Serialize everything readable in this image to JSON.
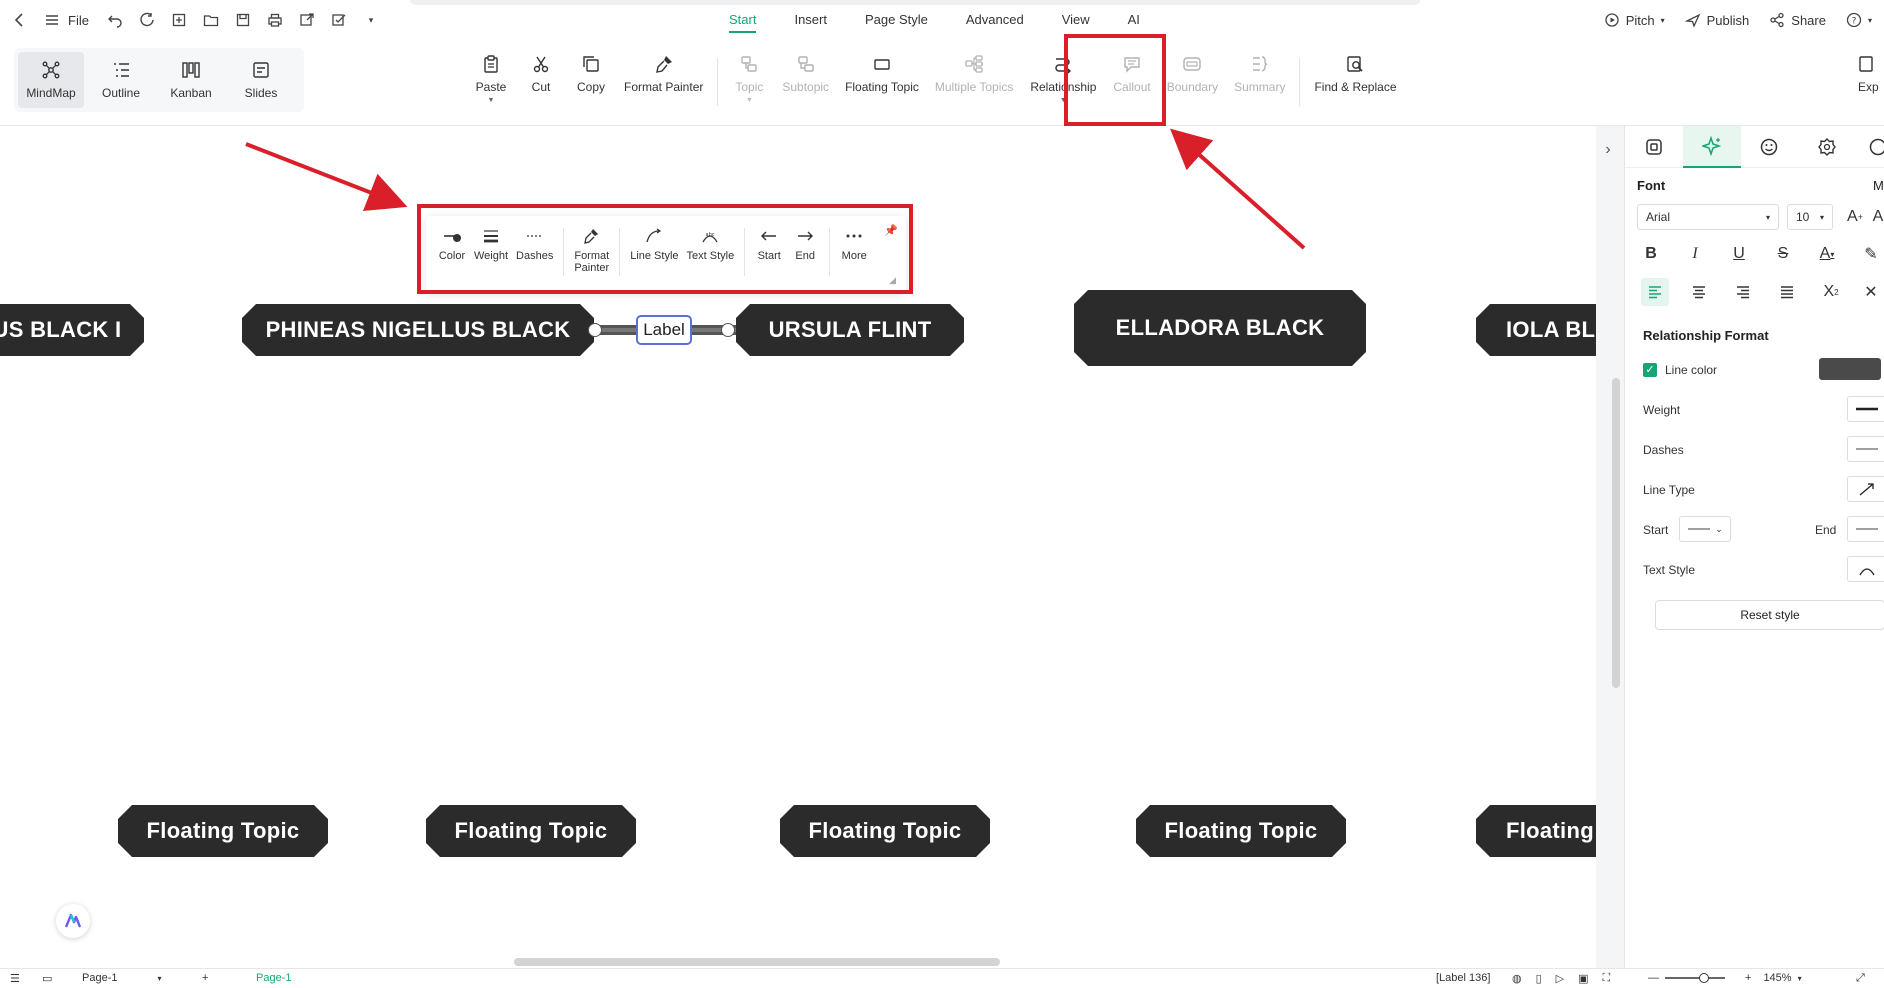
{
  "titlebar": {
    "file_label": "File",
    "tabs": [
      {
        "label": "Start",
        "active": true
      },
      {
        "label": "Insert"
      },
      {
        "label": "Page Style"
      },
      {
        "label": "Advanced"
      },
      {
        "label": "View"
      },
      {
        "label": "AI"
      }
    ],
    "right": {
      "pitch": "Pitch",
      "publish": "Publish",
      "share": "Share"
    }
  },
  "ribbon": {
    "views": [
      {
        "label": "MindMap",
        "icon": "mindmap-icon",
        "active": true
      },
      {
        "label": "Outline",
        "icon": "outline-icon"
      },
      {
        "label": "Kanban",
        "icon": "kanban-icon"
      },
      {
        "label": "Slides",
        "icon": "slides-icon"
      }
    ],
    "tools": {
      "paste": "Paste",
      "cut": "Cut",
      "copy": "Copy",
      "format_painter": "Format Painter",
      "topic": "Topic",
      "subtopic": "Subtopic",
      "floating_topic": "Floating Topic",
      "multiple_topics": "Multiple Topics",
      "relationship": "Relationship",
      "callout": "Callout",
      "boundary": "Boundary",
      "summary": "Summary",
      "find_replace": "Find & Replace",
      "export": "Exp"
    }
  },
  "canvas": {
    "topics": [
      {
        "label": "US BLACK I"
      },
      {
        "label": "PHINEAS NIGELLUS BLACK"
      },
      {
        "label": "URSULA  FLINT"
      },
      {
        "label": "ELLADORA  BLACK"
      },
      {
        "label": "IOLA BLAC"
      }
    ],
    "floating_topics": [
      {
        "label": "Floating Topic"
      },
      {
        "label": "Floating Topic"
      },
      {
        "label": "Floating Topic"
      },
      {
        "label": "Floating Topic"
      },
      {
        "label": "Floating To"
      }
    ],
    "relationship_label": "Label",
    "minibar": {
      "color": "Color",
      "weight": "Weight",
      "dashes": "Dashes",
      "format_painter_1": "Format",
      "format_painter_2": "Painter",
      "line_style": "Line Style",
      "text_style": "Text Style",
      "start": "Start",
      "end": "End",
      "more": "More"
    }
  },
  "panel": {
    "font_heading": "Font",
    "font_more": "M",
    "font_family": "Arial",
    "font_size": "10",
    "relationship_heading": "Relationship Format",
    "line_color": "Line color",
    "line_color_value": "#4a4a4a",
    "weight": "Weight",
    "dashes": "Dashes",
    "line_type": "Line Type",
    "start": "Start",
    "end": "End",
    "text_style": "Text Style",
    "reset": "Reset style"
  },
  "statusbar": {
    "page_select": "Page-1",
    "page_tab": "Page-1",
    "label_count": "[Label 136]",
    "zoom": "145%"
  },
  "colors": {
    "accent": "#17a673",
    "topic_bg": "#2b2b2b",
    "highlight": "#d9202a"
  }
}
